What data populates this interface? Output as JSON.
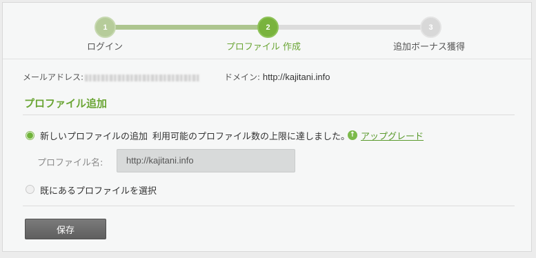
{
  "stepper": {
    "steps": [
      {
        "number": "1",
        "label": "ログイン",
        "state": "completed"
      },
      {
        "number": "2",
        "label": "プロファイル 作成",
        "state": "current"
      },
      {
        "number": "3",
        "label": "追加ボーナス獲得",
        "state": "upcoming"
      }
    ],
    "colors": {
      "completed": "#b6cc9a",
      "current": "#79b33d",
      "upcoming": "#d8d8d8"
    }
  },
  "info": {
    "email_label": "メールアドレス:",
    "domain_label": "ドメイン:",
    "domain_value": "http://kajitani.info"
  },
  "section": {
    "title": "プロファイル追加"
  },
  "options": {
    "new_profile_label": "新しいプロファイルの追加",
    "limit_message": "利用可能のプロファイル数の上限に達しました。",
    "upgrade_link": "アップグレード",
    "upgrade_icon": "arrow-up-icon",
    "existing_profile_label": "既にあるプロファイルを選択",
    "selected": "new"
  },
  "profile_name": {
    "label": "プロファイル名:",
    "value": "http://kajitani.info"
  },
  "actions": {
    "save_label": "保存"
  }
}
